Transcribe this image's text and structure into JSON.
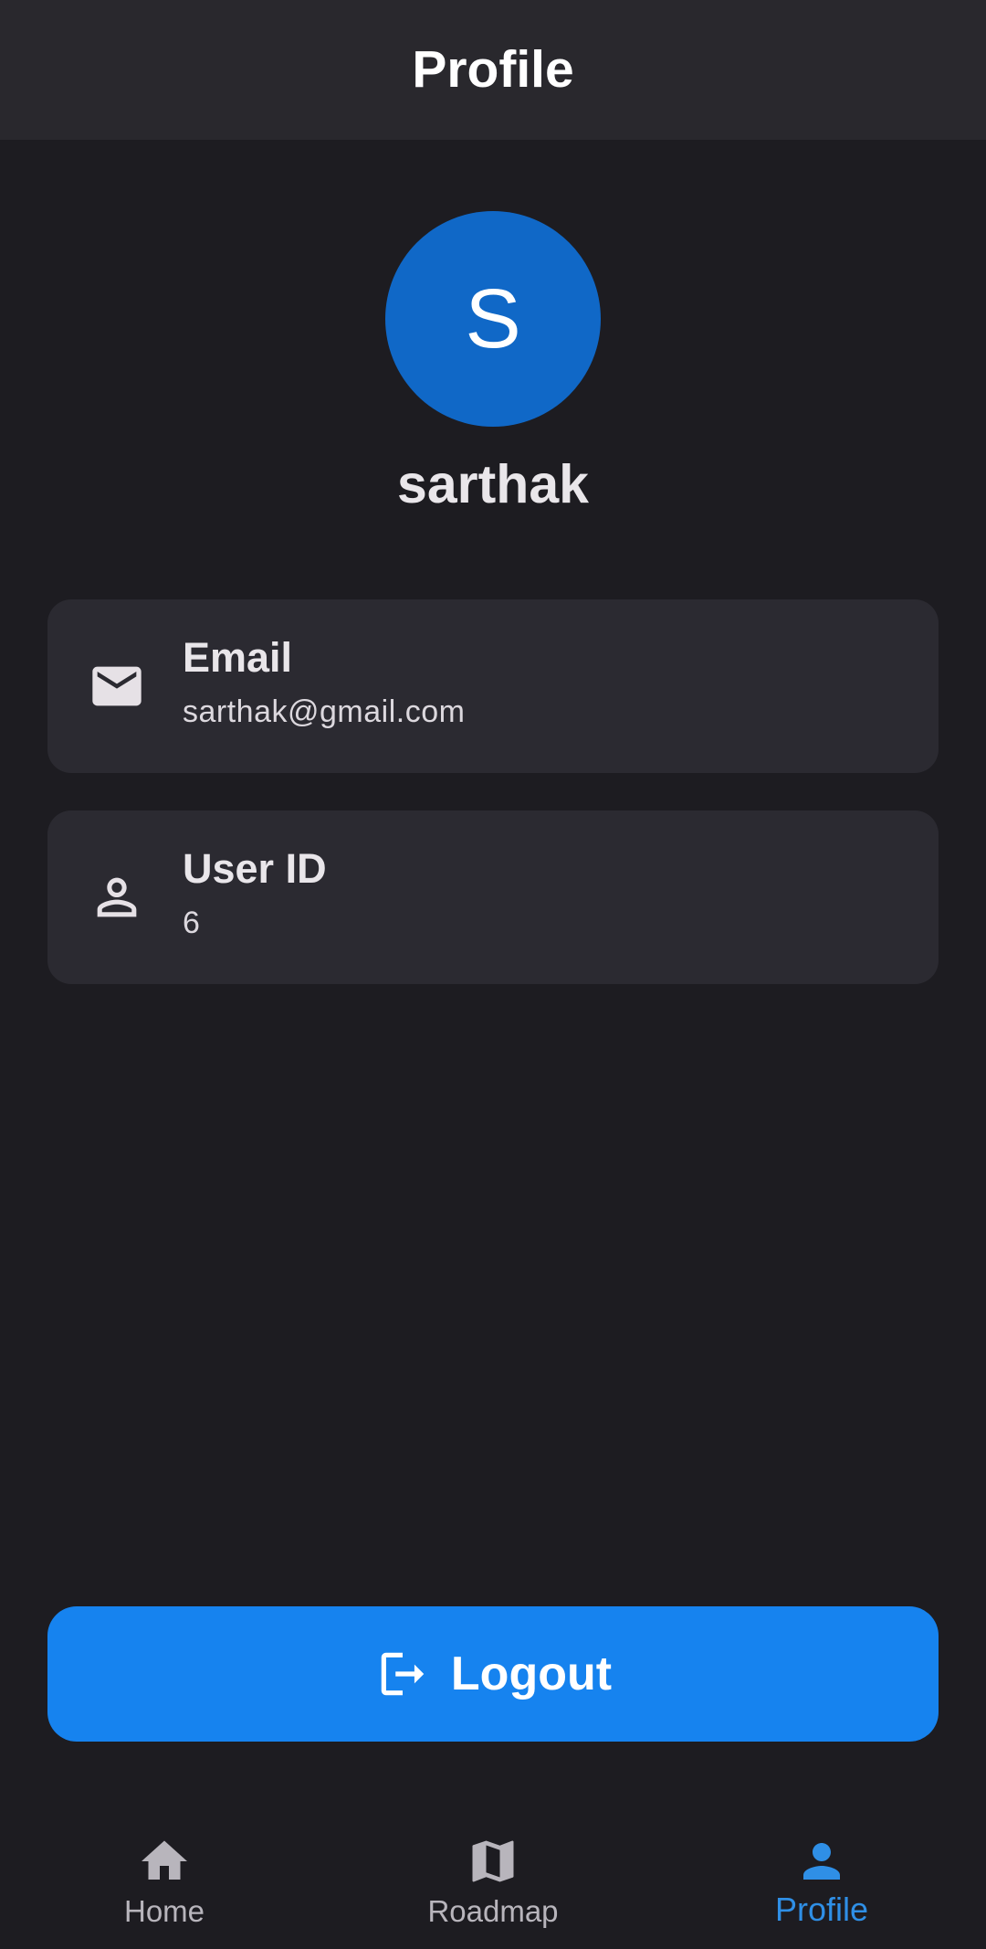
{
  "app_bar": {
    "title": "Profile"
  },
  "profile": {
    "avatar_initial": "S",
    "username": "sarthak",
    "avatar_color": "#1068c7"
  },
  "cards": {
    "email": {
      "title": "Email",
      "value": "sarthak@gmail.com",
      "icon": "mail-icon"
    },
    "user_id": {
      "title": "User ID",
      "value": "6",
      "icon": "person-outline-icon"
    }
  },
  "logout": {
    "label": "Logout",
    "icon": "logout-icon",
    "color": "#1683ef"
  },
  "bottom_nav": {
    "items": [
      {
        "label": "Home",
        "icon": "home-icon",
        "active": false
      },
      {
        "label": "Roadmap",
        "icon": "map-icon",
        "active": false
      },
      {
        "label": "Profile",
        "icon": "person-icon",
        "active": true
      }
    ],
    "active_color": "#2f8fe6",
    "inactive_color": "#b8b5bc"
  }
}
